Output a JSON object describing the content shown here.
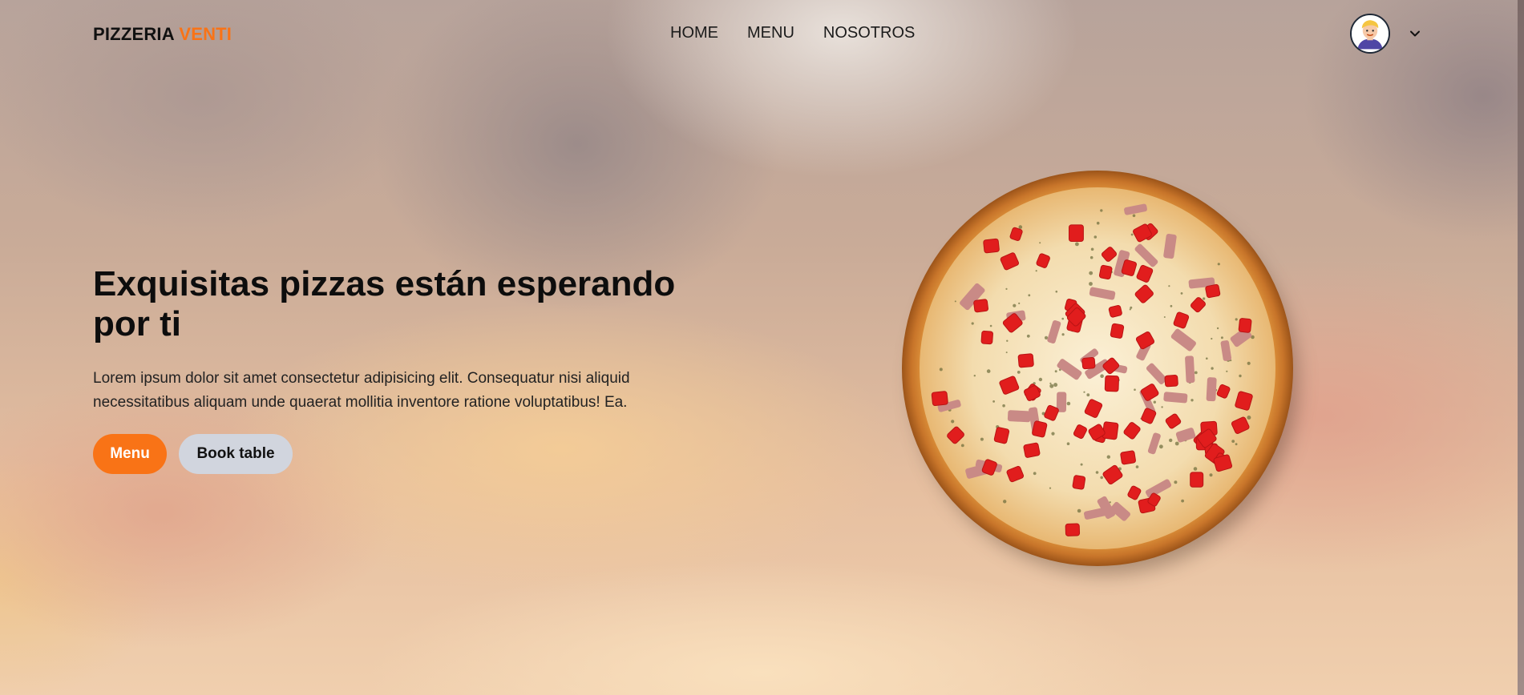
{
  "brand": {
    "name": "PIZZERIA",
    "accent": "VENTI",
    "accent_color": "#f97316"
  },
  "nav": {
    "items": [
      {
        "label": "HOME"
      },
      {
        "label": "MENU"
      },
      {
        "label": "NOSOTROS"
      }
    ]
  },
  "user": {
    "avatar_icon": "user-avatar-icon",
    "dropdown_icon": "chevron-down-icon"
  },
  "hero": {
    "title": "Exquisitas pizzas están esperando por ti",
    "description": "Lorem ipsum dolor sit amet consectetur adipisicing elit. Consequatur nisi aliquid necessitatibus aliquam unde quaerat mollitia inventore ratione voluptatibus! Ea.",
    "buttons": {
      "menu_label": "Menu",
      "book_label": "Book table"
    },
    "button_colors": {
      "menu": "#f97316",
      "book": "#d1d5de"
    }
  },
  "image": {
    "subject": "pizza-image"
  }
}
